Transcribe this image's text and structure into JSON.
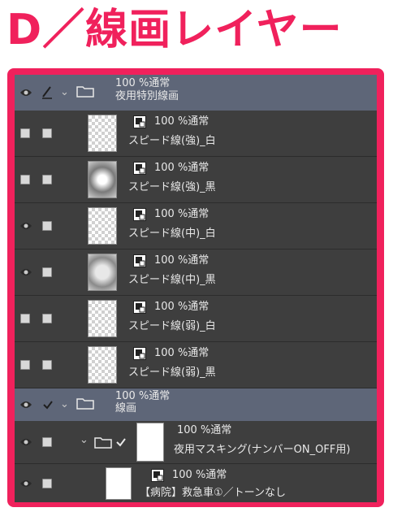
{
  "title": "D／線画レイヤー",
  "colors": {
    "accent": "#f0215c",
    "panel": "#3a3a3a",
    "group_row": "#5e6678"
  },
  "group1": {
    "opacity": "100 %通常",
    "name": "夜用特別線画"
  },
  "layers": [
    {
      "opacity": "100 %通常",
      "name": "スピード線(強)_白",
      "visible": false
    },
    {
      "opacity": "100 %通常",
      "name": "スピード線(強)_黒",
      "visible": false
    },
    {
      "opacity": "100 %通常",
      "name": "スピード線(中)_白",
      "visible": true
    },
    {
      "opacity": "100 %通常",
      "name": "スピード線(中)_黒",
      "visible": true
    },
    {
      "opacity": "100 %通常",
      "name": "スピード線(弱)_白",
      "visible": false
    },
    {
      "opacity": "100 %通常",
      "name": "スピード線(弱)_黒",
      "visible": false
    }
  ],
  "group2": {
    "opacity": "100 %通常",
    "name": "線画"
  },
  "subgroup": {
    "opacity": "100 %通常",
    "name": "夜用マスキング(ナンバーON_OFF用)"
  },
  "lastlayer": {
    "opacity": "100 %通常",
    "name": "【病院】救急車①／トーンなし"
  }
}
